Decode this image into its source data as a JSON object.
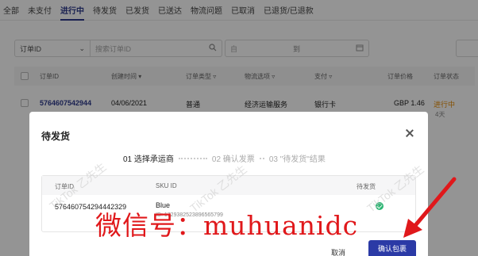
{
  "tabs": [
    {
      "label": "全部"
    },
    {
      "label": "未支付"
    },
    {
      "label": "进行中",
      "active": true
    },
    {
      "label": "待发货"
    },
    {
      "label": "已发货"
    },
    {
      "label": "已送达"
    },
    {
      "label": "物流问题"
    },
    {
      "label": "已取消"
    },
    {
      "label": "已退货/已退款"
    }
  ],
  "filters": {
    "id_select": "订单ID",
    "search_placeholder": "搜索订单ID",
    "date_from": "自",
    "date_sep": "到"
  },
  "orders_table": {
    "headers": [
      "订单ID",
      "创建时间",
      "订单类型",
      "物流选项",
      "支付",
      "订单价格",
      "订单状态"
    ],
    "row": {
      "order_id": "5764607542944",
      "created": "04/06/2021",
      "type": "普通",
      "shipping": "经济运输服务",
      "payment": "银行卡",
      "price": "GBP 1.46",
      "status": "进行中",
      "status_sub": "4天"
    }
  },
  "modal": {
    "title": "待发货",
    "steps": [
      "01 选择承运商",
      "02 确认发票",
      "03 \"待发货\"结果"
    ],
    "inner_table": {
      "headers": [
        "订单ID",
        "SKU ID",
        "待发货"
      ],
      "row": {
        "order_id": "576460754294442329",
        "sku_name": "Blue",
        "sku_id": "ID: 1729382523896565799"
      }
    },
    "cancel_label": "取消",
    "confirm_label": "确认包裹"
  },
  "overlay_text": {
    "watermark": "TikTok 乙先生",
    "promo": "微信号：muhuanidc"
  },
  "colors": {
    "accent": "#2d3a8c",
    "confirm": "#2b3aa6",
    "success": "#2bb673",
    "status": "#e58a00",
    "promo_red": "#e0181b"
  }
}
